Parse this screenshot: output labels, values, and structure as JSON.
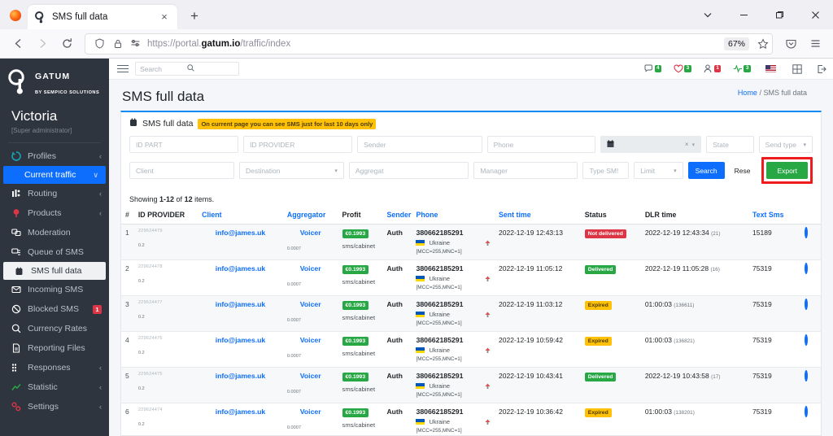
{
  "browser": {
    "tab": {
      "title": "SMS full data",
      "favicon": "gatum-favicon",
      "close": "×"
    },
    "newtab_label": "+",
    "window_controls": {
      "list_all_tabs": "∨",
      "minimize": "–",
      "restore": "❐",
      "close": "×"
    },
    "nav": {
      "back": "←",
      "forward": "→",
      "reload": "⟳"
    },
    "url": {
      "prefix": "https://portal.",
      "domain": "gatum.io",
      "path": "/traffic/index"
    },
    "url_icons": {
      "shield": "shield-icon",
      "lock": "lock-icon",
      "tracking": "tracking-protection-icon"
    },
    "zoom_level": "67%",
    "bookmark": "☆",
    "pocket": "pocket-icon",
    "menu": "≡"
  },
  "sidebar": {
    "brand": {
      "name": "GATUM",
      "subtitle": "BY SEMPICO SOLUTIONS"
    },
    "user": {
      "name": "Victoria",
      "role": "[Super administrator]"
    },
    "items": [
      {
        "label": "Profiles",
        "icon": "profiles-icon",
        "caret": "‹",
        "state": "normal",
        "badge": ""
      },
      {
        "label": "Current traffic",
        "icon": "",
        "caret": "∨",
        "state": "active",
        "badge": ""
      },
      {
        "label": "Routing",
        "icon": "routing-icon",
        "caret": "‹",
        "state": "normal",
        "badge": ""
      },
      {
        "label": "Products",
        "icon": "products-icon",
        "caret": "‹",
        "state": "normal",
        "badge": ""
      },
      {
        "label": "Moderation",
        "icon": "moderation-icon",
        "caret": "",
        "state": "normal",
        "badge": ""
      },
      {
        "label": "Queue of SMS",
        "icon": "queue-icon",
        "caret": "",
        "state": "normal",
        "badge": ""
      },
      {
        "label": "SMS full data",
        "icon": "sms-full-data-icon",
        "caret": "",
        "state": "selected",
        "badge": ""
      },
      {
        "label": "Incoming SMS",
        "icon": "incoming-sms-icon",
        "caret": "",
        "state": "normal",
        "badge": ""
      },
      {
        "label": "Blocked SMS",
        "icon": "blocked-sms-icon",
        "caret": "",
        "state": "normal",
        "badge": "1"
      },
      {
        "label": "Currency Rates",
        "icon": "currency-rates-icon",
        "caret": "",
        "state": "normal",
        "badge": ""
      },
      {
        "label": "Reporting Files",
        "icon": "reporting-files-icon",
        "caret": "",
        "state": "normal",
        "badge": ""
      },
      {
        "label": "Responses",
        "icon": "responses-icon",
        "caret": "‹",
        "state": "normal",
        "badge": ""
      },
      {
        "label": "Statistic",
        "icon": "statistic-icon",
        "caret": "‹",
        "state": "normal",
        "badge": ""
      },
      {
        "label": "Settings",
        "icon": "settings-icon",
        "caret": "‹",
        "state": "normal",
        "badge": ""
      }
    ]
  },
  "topbar": {
    "menu_toggle": "hamburger-icon",
    "search_placeholder": "Search",
    "search_icon": "search-icon",
    "icons": [
      {
        "name": "sms-counter-icon",
        "count": "4",
        "color": "green"
      },
      {
        "name": "alerts-counter-icon",
        "count": "3",
        "color": "green"
      },
      {
        "name": "users-counter-icon",
        "count": "1",
        "color": "red"
      },
      {
        "name": "status-counter-icon",
        "count": "3",
        "color": "green"
      }
    ],
    "language_flag": "us-flag-icon",
    "grid_icon": "grid-icon",
    "logout_icon": "logout-icon"
  },
  "page": {
    "title": "SMS full data",
    "breadcrumb_home": "Home",
    "breadcrumb_sep": "/",
    "breadcrumb_current": "SMS full data"
  },
  "panel": {
    "icon": "sms-full-data-icon",
    "title": "SMS full data",
    "warning": "On current page you can see SMS just for last 10 days only",
    "accent_color": "#0d8bf2",
    "warning_bg": "#ffc107"
  },
  "filters": {
    "row1": [
      {
        "name": "id-part",
        "placeholder": "ID PART",
        "value": "",
        "type": "text"
      },
      {
        "name": "id-provider",
        "placeholder": "ID PROVIDER",
        "value": "",
        "type": "text"
      },
      {
        "name": "sender",
        "placeholder": "Sender",
        "value": "",
        "type": "text"
      },
      {
        "name": "phone",
        "placeholder": "Phone",
        "value": "",
        "type": "text"
      },
      {
        "name": "date-range",
        "placeholder": "",
        "value": "",
        "type": "date"
      },
      {
        "name": "state",
        "placeholder": "State",
        "value": "",
        "type": "text"
      },
      {
        "name": "send-type",
        "placeholder": "Send type",
        "value": "",
        "type": "select"
      }
    ],
    "row2": [
      {
        "name": "client",
        "placeholder": "Client",
        "value": "",
        "type": "text"
      },
      {
        "name": "destination",
        "placeholder": "Destination",
        "value": "",
        "type": "select"
      },
      {
        "name": "aggregat",
        "placeholder": "Aggregat",
        "value": "",
        "type": "text"
      },
      {
        "name": "manager",
        "placeholder": "Manager",
        "value": "",
        "type": "text"
      },
      {
        "name": "type-sm",
        "placeholder": "Type SM!",
        "value": "",
        "type": "text"
      },
      {
        "name": "limit",
        "placeholder": "Limit",
        "value": "",
        "type": "select"
      }
    ],
    "date_clear": "×",
    "date_caret": "▾",
    "calendar_icon": "calendar-icon",
    "buttons": {
      "search": "Search",
      "reset": "Rese",
      "export": "Export"
    },
    "export_highlight_color": "#ee1c1c"
  },
  "table": {
    "showing_prefix": "Showing ",
    "showing_range": "1-12",
    "showing_mid": " of ",
    "showing_total": "12",
    "showing_suffix": " items.",
    "headers": [
      {
        "label": "#",
        "link": false
      },
      {
        "label": "ID PROVIDER",
        "link": false
      },
      {
        "label": "Client",
        "link": true
      },
      {
        "label": "Aggregator",
        "link": true
      },
      {
        "label": "Profit",
        "link": false
      },
      {
        "label": "Sender",
        "link": true
      },
      {
        "label": "Phone",
        "link": true
      },
      {
        "label": "Sent time",
        "link": true
      },
      {
        "label": "Status",
        "link": false
      },
      {
        "label": "DLR time",
        "link": false
      },
      {
        "label": "Text Sms",
        "link": true
      },
      {
        "label": "",
        "link": false
      }
    ],
    "rows": [
      {
        "num": "1",
        "id_provider": "229624479",
        "id_sub": "0.2",
        "client": "info@james.uk",
        "aggregator": "Voicer",
        "aggregator_sub": "0.0007",
        "profit": "€0.1993",
        "profit_sub": "sms/cabinet",
        "sender": "Auth",
        "phone": "380662185291",
        "country": "Ukraine",
        "mcc": "[MCC=255,MNC=1]",
        "sent_time": "2022-12-19 12:43:13",
        "status": "Not delivered",
        "status_kind": "notdel",
        "dlr_time": "2022-12-19 12:43:34",
        "dlr_sub": "(21)",
        "text_sms": "15189",
        "view_icon": "view-icon"
      },
      {
        "num": "2",
        "id_provider": "229624478",
        "id_sub": "0.2",
        "client": "info@james.uk",
        "aggregator": "Voicer",
        "aggregator_sub": "0.0007",
        "profit": "€0.1993",
        "profit_sub": "sms/cabinet",
        "sender": "Auth",
        "phone": "380662185291",
        "country": "Ukraine",
        "mcc": "[MCC=255,MNC=1]",
        "sent_time": "2022-12-19 11:05:12",
        "status": "Delivered",
        "status_kind": "del",
        "dlr_time": "2022-12-19 11:05:28",
        "dlr_sub": "(16)",
        "text_sms": "75319",
        "view_icon": "view-icon"
      },
      {
        "num": "3",
        "id_provider": "229624477",
        "id_sub": "0.2",
        "client": "info@james.uk",
        "aggregator": "Voicer",
        "aggregator_sub": "0.0007",
        "profit": "€0.1993",
        "profit_sub": "sms/cabinet",
        "sender": "Auth",
        "phone": "380662185291",
        "country": "Ukraine",
        "mcc": "[MCC=255,MNC=1]",
        "sent_time": "2022-12-19 11:03:12",
        "status": "Expired",
        "status_kind": "exp",
        "dlr_time": "01:00:03",
        "dlr_sub": "(136611)",
        "text_sms": "75319",
        "view_icon": "view-icon"
      },
      {
        "num": "4",
        "id_provider": "229624476",
        "id_sub": "0.2",
        "client": "info@james.uk",
        "aggregator": "Voicer",
        "aggregator_sub": "0.0007",
        "profit": "€0.1993",
        "profit_sub": "sms/cabinet",
        "sender": "Auth",
        "phone": "380662185291",
        "country": "Ukraine",
        "mcc": "[MCC=255,MNC=1]",
        "sent_time": "2022-12-19 10:59:42",
        "status": "Expired",
        "status_kind": "exp",
        "dlr_time": "01:00:03",
        "dlr_sub": "(136821)",
        "text_sms": "75319",
        "view_icon": "view-icon"
      },
      {
        "num": "5",
        "id_provider": "229624475",
        "id_sub": "0.2",
        "client": "info@james.uk",
        "aggregator": "Voicer",
        "aggregator_sub": "0.0007",
        "profit": "€0.1993",
        "profit_sub": "sms/cabinet",
        "sender": "Auth",
        "phone": "380662185291",
        "country": "Ukraine",
        "mcc": "[MCC=255,MNC=1]",
        "sent_time": "2022-12-19 10:43:41",
        "status": "Delivered",
        "status_kind": "del",
        "dlr_time": "2022-12-19 10:43:58",
        "dlr_sub": "(17)",
        "text_sms": "75319",
        "view_icon": "view-icon"
      },
      {
        "num": "6",
        "id_provider": "229624474",
        "id_sub": "0.2",
        "client": "info@james.uk",
        "aggregator": "Voicer",
        "aggregator_sub": "0.0007",
        "profit": "€0.1993",
        "profit_sub": "sms/cabinet",
        "sender": "Auth",
        "phone": "380662185291",
        "country": "Ukraine",
        "mcc": "[MCC=255,MNC=1]",
        "sent_time": "2022-12-19 10:36:42",
        "status": "Expired",
        "status_kind": "exp",
        "dlr_time": "01:00:03",
        "dlr_sub": "(138201)",
        "text_sms": "75319",
        "view_icon": "view-icon"
      }
    ]
  }
}
